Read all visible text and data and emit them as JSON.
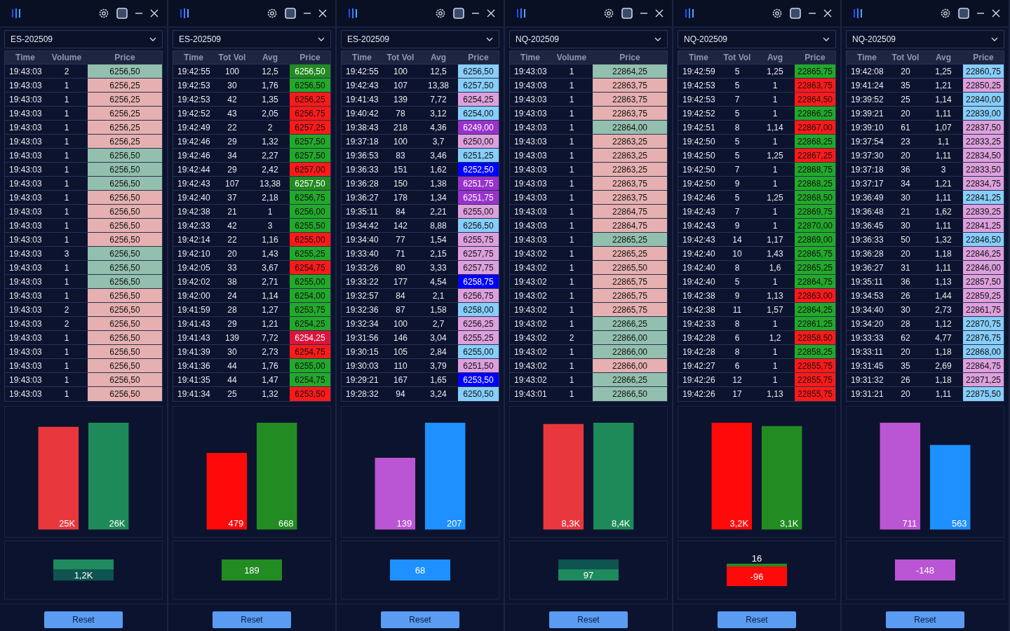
{
  "panels": [
    {
      "symbol": "ES-202509",
      "columns": [
        "Time",
        "Volume",
        "Price"
      ],
      "rows": [
        {
          "cells": [
            "19:43:03",
            "2",
            "6256,50"
          ],
          "color": "#93bfae"
        },
        {
          "cells": [
            "19:43:03",
            "1",
            "6256,25"
          ],
          "color": "#e6b0b0"
        },
        {
          "cells": [
            "19:43:03",
            "1",
            "6256,25"
          ],
          "color": "#e6b0b0"
        },
        {
          "cells": [
            "19:43:03",
            "1",
            "6256,25"
          ],
          "color": "#e6b0b0"
        },
        {
          "cells": [
            "19:43:03",
            "1",
            "6256,25"
          ],
          "color": "#e6b0b0"
        },
        {
          "cells": [
            "19:43:03",
            "1",
            "6256,25"
          ],
          "color": "#e6b0b0"
        },
        {
          "cells": [
            "19:43:03",
            "1",
            "6256,50"
          ],
          "color": "#93bfae"
        },
        {
          "cells": [
            "19:43:03",
            "1",
            "6256,50"
          ],
          "color": "#93bfae"
        },
        {
          "cells": [
            "19:43:03",
            "1",
            "6256,50"
          ],
          "color": "#93bfae"
        },
        {
          "cells": [
            "19:43:03",
            "1",
            "6256,50"
          ],
          "color": "#e6b0b0"
        },
        {
          "cells": [
            "19:43:03",
            "1",
            "6256,50"
          ],
          "color": "#e6b0b0"
        },
        {
          "cells": [
            "19:43:03",
            "1",
            "6256,50"
          ],
          "color": "#e6b0b0"
        },
        {
          "cells": [
            "19:43:03",
            "1",
            "6256,50"
          ],
          "color": "#e6b0b0"
        },
        {
          "cells": [
            "19:43:03",
            "3",
            "6256,50"
          ],
          "color": "#93bfae"
        },
        {
          "cells": [
            "19:43:03",
            "1",
            "6256,50"
          ],
          "color": "#93bfae"
        },
        {
          "cells": [
            "19:43:03",
            "1",
            "6256,50"
          ],
          "color": "#93bfae"
        },
        {
          "cells": [
            "19:43:03",
            "1",
            "6256,50"
          ],
          "color": "#e6b0b0"
        },
        {
          "cells": [
            "19:43:03",
            "2",
            "6256,50"
          ],
          "color": "#e6b0b0"
        },
        {
          "cells": [
            "19:43:03",
            "2",
            "6256,50"
          ],
          "color": "#e6b0b0"
        },
        {
          "cells": [
            "19:43:03",
            "1",
            "6256,50"
          ],
          "color": "#e6b0b0"
        },
        {
          "cells": [
            "19:43:03",
            "1",
            "6256,50"
          ],
          "color": "#e6b0b0"
        },
        {
          "cells": [
            "19:43:03",
            "1",
            "6256,50"
          ],
          "color": "#e6b0b0"
        },
        {
          "cells": [
            "19:43:03",
            "1",
            "6256,50"
          ],
          "color": "#e6b0b0"
        },
        {
          "cells": [
            "19:43:03",
            "1",
            "6256,50"
          ],
          "color": "#e6b0b0"
        }
      ],
      "chart_data": {
        "type": "bar",
        "values": [
          25000,
          26000
        ],
        "value_labels": [
          "25K",
          "26K"
        ],
        "colors": [
          "#e8383d",
          "#1e8a5a"
        ]
      },
      "delta": {
        "label": "1,2K",
        "color": "#0e5450",
        "cap": {
          "color": "#1e8a5e"
        }
      },
      "reset": "Reset"
    },
    {
      "symbol": "ES-202509",
      "columns": [
        "Time",
        "Tot Vol",
        "Avg",
        "Price"
      ],
      "rows": [
        {
          "cells": [
            "19:42:55",
            "100",
            "12,5",
            "6256,50"
          ],
          "color": "#228b22"
        },
        {
          "cells": [
            "19:42:53",
            "30",
            "1,76",
            "6256,50"
          ],
          "color": "#22a82a"
        },
        {
          "cells": [
            "19:42:53",
            "42",
            "1,35",
            "6256,25"
          ],
          "color": "#ff1a1a"
        },
        {
          "cells": [
            "19:42:52",
            "43",
            "2,05",
            "6256,75"
          ],
          "color": "#ff1a1a"
        },
        {
          "cells": [
            "19:42:49",
            "22",
            "2",
            "6257,25"
          ],
          "color": "#ff1a1a"
        },
        {
          "cells": [
            "19:42:46",
            "29",
            "1,32",
            "6257,50"
          ],
          "color": "#22a82a"
        },
        {
          "cells": [
            "19:42:46",
            "34",
            "2,27",
            "6257,50"
          ],
          "color": "#22a82a"
        },
        {
          "cells": [
            "19:42:44",
            "29",
            "2,42",
            "6257,00"
          ],
          "color": "#ff1a1a"
        },
        {
          "cells": [
            "19:42:43",
            "107",
            "13,38",
            "6257,50"
          ],
          "color": "#228b22"
        },
        {
          "cells": [
            "19:42:40",
            "37",
            "2,18",
            "6256,75"
          ],
          "color": "#22a82a"
        },
        {
          "cells": [
            "19:42:38",
            "21",
            "1",
            "6256,00"
          ],
          "color": "#22a82a"
        },
        {
          "cells": [
            "19:42:33",
            "42",
            "3",
            "6255,50"
          ],
          "color": "#22a82a"
        },
        {
          "cells": [
            "19:42:14",
            "22",
            "1,16",
            "6255,00"
          ],
          "color": "#ff1a1a"
        },
        {
          "cells": [
            "19:42:10",
            "20",
            "1,43",
            "6255,25"
          ],
          "color": "#22a82a"
        },
        {
          "cells": [
            "19:42:05",
            "33",
            "3,67",
            "6254,75"
          ],
          "color": "#ff1a1a"
        },
        {
          "cells": [
            "19:42:02",
            "38",
            "2,71",
            "6255,00"
          ],
          "color": "#22a82a"
        },
        {
          "cells": [
            "19:42:00",
            "24",
            "1,14",
            "6254,00"
          ],
          "color": "#22a82a"
        },
        {
          "cells": [
            "19:41:59",
            "28",
            "1,27",
            "6253,75"
          ],
          "color": "#22a82a"
        },
        {
          "cells": [
            "19:41:43",
            "29",
            "1,21",
            "6254,25"
          ],
          "color": "#22a82a"
        },
        {
          "cells": [
            "19:41:43",
            "139",
            "7,72",
            "6254,25"
          ],
          "color": "#dc143c"
        },
        {
          "cells": [
            "19:41:39",
            "30",
            "2,73",
            "6254,75"
          ],
          "color": "#ff1a1a"
        },
        {
          "cells": [
            "19:41:36",
            "44",
            "1,76",
            "6255,00"
          ],
          "color": "#22a82a"
        },
        {
          "cells": [
            "19:41:35",
            "44",
            "1,47",
            "6254,75"
          ],
          "color": "#22a82a"
        },
        {
          "cells": [
            "19:41:34",
            "25",
            "1,32",
            "6253,50"
          ],
          "color": "#ff1a1a"
        }
      ],
      "chart_data": {
        "type": "bar",
        "values": [
          479,
          668
        ],
        "value_labels": [
          "479",
          "668"
        ],
        "colors": [
          "#ff0a0a",
          "#228b22"
        ]
      },
      "delta": {
        "label": "189",
        "color": "#228b22"
      },
      "reset": "Reset"
    },
    {
      "symbol": "ES-202509",
      "columns": [
        "Time",
        "Tot Vol",
        "Avg",
        "Price"
      ],
      "rows": [
        {
          "cells": [
            "19:42:55",
            "100",
            "12,5",
            "6256,50"
          ],
          "color": "#87cefa"
        },
        {
          "cells": [
            "19:42:43",
            "107",
            "13,38",
            "6257,50"
          ],
          "color": "#87cefa"
        },
        {
          "cells": [
            "19:41:43",
            "139",
            "7,72",
            "6254,25"
          ],
          "color": "#dda0dd"
        },
        {
          "cells": [
            "19:40:42",
            "78",
            "3,12",
            "6254,00"
          ],
          "color": "#87cefa"
        },
        {
          "cells": [
            "19:38:43",
            "218",
            "4,36",
            "6249,00"
          ],
          "color": "#9932cc"
        },
        {
          "cells": [
            "19:37:18",
            "100",
            "3,7",
            "6250,00"
          ],
          "color": "#dda0dd"
        },
        {
          "cells": [
            "19:36:53",
            "83",
            "3,46",
            "6251,25"
          ],
          "color": "#87cefa"
        },
        {
          "cells": [
            "19:36:33",
            "151",
            "1,62",
            "6252,50"
          ],
          "color": "#0000ff"
        },
        {
          "cells": [
            "19:36:28",
            "150",
            "1,38",
            "6251,75"
          ],
          "color": "#9932cc"
        },
        {
          "cells": [
            "19:36:27",
            "178",
            "1,34",
            "6251,75"
          ],
          "color": "#9932cc"
        },
        {
          "cells": [
            "19:35:11",
            "84",
            "2,21",
            "6255,00"
          ],
          "color": "#dda0dd"
        },
        {
          "cells": [
            "19:34:42",
            "142",
            "8,88",
            "6256,50"
          ],
          "color": "#87cefa"
        },
        {
          "cells": [
            "19:34:40",
            "77",
            "1,54",
            "6255,75"
          ],
          "color": "#dda0dd"
        },
        {
          "cells": [
            "19:33:40",
            "71",
            "2,15",
            "6257,75"
          ],
          "color": "#dda0dd"
        },
        {
          "cells": [
            "19:33:26",
            "80",
            "3,33",
            "6257,75"
          ],
          "color": "#dda0dd"
        },
        {
          "cells": [
            "19:33:22",
            "177",
            "4,54",
            "6258,75"
          ],
          "color": "#0000ff"
        },
        {
          "cells": [
            "19:32:57",
            "84",
            "2,1",
            "6256,75"
          ],
          "color": "#dda0dd"
        },
        {
          "cells": [
            "19:32:36",
            "87",
            "1,58",
            "6258,00"
          ],
          "color": "#87cefa"
        },
        {
          "cells": [
            "19:32:34",
            "100",
            "2,7",
            "6256,25"
          ],
          "color": "#dda0dd"
        },
        {
          "cells": [
            "19:31:56",
            "146",
            "3,04",
            "6255,25"
          ],
          "color": "#dda0dd"
        },
        {
          "cells": [
            "19:30:15",
            "105",
            "2,84",
            "6255,00"
          ],
          "color": "#87cefa"
        },
        {
          "cells": [
            "19:30:03",
            "110",
            "3,79",
            "6251,50"
          ],
          "color": "#dda0dd"
        },
        {
          "cells": [
            "19:29:21",
            "167",
            "1,65",
            "6253,50"
          ],
          "color": "#0000ff"
        },
        {
          "cells": [
            "19:28:32",
            "94",
            "3,24",
            "6250,50"
          ],
          "color": "#87cefa"
        }
      ],
      "chart_data": {
        "type": "bar",
        "values": [
          139,
          207
        ],
        "value_labels": [
          "139",
          "207"
        ],
        "colors": [
          "#ba55d3",
          "#1e90ff"
        ]
      },
      "delta": {
        "label": "68",
        "color": "#1e90ff"
      },
      "reset": "Reset"
    },
    {
      "symbol": "NQ-202509",
      "columns": [
        "Time",
        "Volume",
        "Price"
      ],
      "rows": [
        {
          "cells": [
            "19:43:03",
            "1",
            "22864,25"
          ],
          "color": "#93bfae"
        },
        {
          "cells": [
            "19:43:03",
            "1",
            "22863,75"
          ],
          "color": "#e6b0b0"
        },
        {
          "cells": [
            "19:43:03",
            "1",
            "22863,75"
          ],
          "color": "#e6b0b0"
        },
        {
          "cells": [
            "19:43:03",
            "1",
            "22863,75"
          ],
          "color": "#e6b0b0"
        },
        {
          "cells": [
            "19:43:03",
            "1",
            "22864,00"
          ],
          "color": "#93bfae"
        },
        {
          "cells": [
            "19:43:03",
            "1",
            "22863,25"
          ],
          "color": "#e6b0b0"
        },
        {
          "cells": [
            "19:43:03",
            "1",
            "22863,25"
          ],
          "color": "#e6b0b0"
        },
        {
          "cells": [
            "19:43:03",
            "1",
            "22863,25"
          ],
          "color": "#e6b0b0"
        },
        {
          "cells": [
            "19:43:03",
            "1",
            "22863,75"
          ],
          "color": "#e6b0b0"
        },
        {
          "cells": [
            "19:43:03",
            "1",
            "22863,75"
          ],
          "color": "#e6b0b0"
        },
        {
          "cells": [
            "19:43:03",
            "1",
            "22864,75"
          ],
          "color": "#e6b0b0"
        },
        {
          "cells": [
            "19:43:03",
            "1",
            "22864,75"
          ],
          "color": "#e6b0b0"
        },
        {
          "cells": [
            "19:43:03",
            "1",
            "22865,25"
          ],
          "color": "#93bfae"
        },
        {
          "cells": [
            "19:43:02",
            "1",
            "22865,25"
          ],
          "color": "#e6b0b0"
        },
        {
          "cells": [
            "19:43:02",
            "1",
            "22865,50"
          ],
          "color": "#e6b0b0"
        },
        {
          "cells": [
            "19:43:02",
            "1",
            "22865,75"
          ],
          "color": "#e6b0b0"
        },
        {
          "cells": [
            "19:43:02",
            "1",
            "22865,75"
          ],
          "color": "#e6b0b0"
        },
        {
          "cells": [
            "19:43:02",
            "1",
            "22865,75"
          ],
          "color": "#e6b0b0"
        },
        {
          "cells": [
            "19:43:02",
            "1",
            "22866,25"
          ],
          "color": "#93bfae"
        },
        {
          "cells": [
            "19:43:02",
            "2",
            "22866,00"
          ],
          "color": "#93bfae"
        },
        {
          "cells": [
            "19:43:02",
            "1",
            "22866,00"
          ],
          "color": "#93bfae"
        },
        {
          "cells": [
            "19:43:02",
            "1",
            "22866,00"
          ],
          "color": "#e6b0b0"
        },
        {
          "cells": [
            "19:43:02",
            "1",
            "22866,25"
          ],
          "color": "#93bfae"
        },
        {
          "cells": [
            "19:43:01",
            "1",
            "22866,50"
          ],
          "color": "#93bfae"
        }
      ],
      "chart_data": {
        "type": "bar",
        "values": [
          8300,
          8400
        ],
        "value_labels": [
          "8,3K",
          "8,4K"
        ],
        "colors": [
          "#e8383d",
          "#1e8a5a"
        ]
      },
      "delta": {
        "label": "97",
        "color": "#1e8a5e",
        "cap": {
          "color": "#0e5450"
        }
      },
      "reset": "Reset"
    },
    {
      "symbol": "NQ-202509",
      "columns": [
        "Time",
        "Tot Vol",
        "Avg",
        "Price"
      ],
      "rows": [
        {
          "cells": [
            "19:42:59",
            "5",
            "1,25",
            "22865,75"
          ],
          "color": "#22a82a"
        },
        {
          "cells": [
            "19:42:53",
            "5",
            "1",
            "22863,75"
          ],
          "color": "#ff1a1a"
        },
        {
          "cells": [
            "19:42:53",
            "7",
            "1",
            "22864,50"
          ],
          "color": "#ff1a1a"
        },
        {
          "cells": [
            "19:42:52",
            "5",
            "1",
            "22866,25"
          ],
          "color": "#22a82a"
        },
        {
          "cells": [
            "19:42:51",
            "8",
            "1,14",
            "22867,00"
          ],
          "color": "#ff1a1a"
        },
        {
          "cells": [
            "19:42:50",
            "5",
            "1",
            "22868,25"
          ],
          "color": "#22a82a"
        },
        {
          "cells": [
            "19:42:50",
            "5",
            "1,25",
            "22867,25"
          ],
          "color": "#ff1a1a"
        },
        {
          "cells": [
            "19:42:50",
            "7",
            "1",
            "22868,75"
          ],
          "color": "#22a82a"
        },
        {
          "cells": [
            "19:42:50",
            "9",
            "1",
            "22868,25"
          ],
          "color": "#22a82a"
        },
        {
          "cells": [
            "19:42:46",
            "5",
            "1,25",
            "22868,50"
          ],
          "color": "#22a82a"
        },
        {
          "cells": [
            "19:42:43",
            "7",
            "1",
            "22869,75"
          ],
          "color": "#22a82a"
        },
        {
          "cells": [
            "19:42:43",
            "9",
            "1",
            "22870,00"
          ],
          "color": "#22a82a"
        },
        {
          "cells": [
            "19:42:43",
            "14",
            "1,17",
            "22869,00"
          ],
          "color": "#22a82a"
        },
        {
          "cells": [
            "19:42:40",
            "10",
            "1,43",
            "22865,75"
          ],
          "color": "#22a82a"
        },
        {
          "cells": [
            "19:42:40",
            "8",
            "1,6",
            "22865,25"
          ],
          "color": "#22a82a"
        },
        {
          "cells": [
            "19:42:40",
            "5",
            "1",
            "22864,75"
          ],
          "color": "#22a82a"
        },
        {
          "cells": [
            "19:42:38",
            "9",
            "1,13",
            "22863,00"
          ],
          "color": "#ff1a1a"
        },
        {
          "cells": [
            "19:42:38",
            "11",
            "1,57",
            "22864,25"
          ],
          "color": "#22a82a"
        },
        {
          "cells": [
            "19:42:33",
            "8",
            "1",
            "22861,25"
          ],
          "color": "#22a82a"
        },
        {
          "cells": [
            "19:42:28",
            "6",
            "1,2",
            "22858,50"
          ],
          "color": "#ff1a1a"
        },
        {
          "cells": [
            "19:42:28",
            "8",
            "1",
            "22858,25"
          ],
          "color": "#22a82a"
        },
        {
          "cells": [
            "19:42:27",
            "6",
            "1",
            "22855,75"
          ],
          "color": "#ff1a1a"
        },
        {
          "cells": [
            "19:42:26",
            "12",
            "1",
            "22855,75"
          ],
          "color": "#ff1a1a"
        },
        {
          "cells": [
            "19:42:26",
            "17",
            "1,13",
            "22855,75"
          ],
          "color": "#ff1a1a"
        }
      ],
      "chart_data": {
        "type": "bar",
        "values": [
          3200,
          3100
        ],
        "value_labels": [
          "3,2K",
          "3,1K"
        ],
        "colors": [
          "#ff0a0a",
          "#228b22"
        ]
      },
      "delta": {
        "label": "-96",
        "color": "#ff0a0a",
        "cap": {
          "color": "#228b22",
          "label": "16"
        }
      },
      "reset": "Reset"
    },
    {
      "symbol": "NQ-202509",
      "columns": [
        "Time",
        "Tot Vol",
        "Avg",
        "Price"
      ],
      "rows": [
        {
          "cells": [
            "19:42:08",
            "20",
            "1,25",
            "22860,75"
          ],
          "color": "#87cefa"
        },
        {
          "cells": [
            "19:41:24",
            "35",
            "1,21",
            "22850,25"
          ],
          "color": "#dda0dd"
        },
        {
          "cells": [
            "19:39:52",
            "25",
            "1,14",
            "22840,00"
          ],
          "color": "#87cefa"
        },
        {
          "cells": [
            "19:39:21",
            "20",
            "1,11",
            "22839,00"
          ],
          "color": "#87cefa"
        },
        {
          "cells": [
            "19:39:10",
            "61",
            "1,07",
            "22837,50"
          ],
          "color": "#dda0dd"
        },
        {
          "cells": [
            "19:37:54",
            "23",
            "1,1",
            "22833,25"
          ],
          "color": "#dda0dd"
        },
        {
          "cells": [
            "19:37:30",
            "20",
            "1,11",
            "22834,50"
          ],
          "color": "#dda0dd"
        },
        {
          "cells": [
            "19:37:18",
            "36",
            "3",
            "22833,50"
          ],
          "color": "#dda0dd"
        },
        {
          "cells": [
            "19:37:17",
            "34",
            "1,21",
            "22834,75"
          ],
          "color": "#dda0dd"
        },
        {
          "cells": [
            "19:36:49",
            "30",
            "1,11",
            "22841,25"
          ],
          "color": "#87cefa"
        },
        {
          "cells": [
            "19:36:48",
            "21",
            "1,62",
            "22839,25"
          ],
          "color": "#dda0dd"
        },
        {
          "cells": [
            "19:36:45",
            "30",
            "1,11",
            "22841,25"
          ],
          "color": "#dda0dd"
        },
        {
          "cells": [
            "19:36:33",
            "50",
            "1,32",
            "22846,50"
          ],
          "color": "#87cefa"
        },
        {
          "cells": [
            "19:36:28",
            "20",
            "1,18",
            "22846,25"
          ],
          "color": "#dda0dd"
        },
        {
          "cells": [
            "19:36:27",
            "31",
            "1,11",
            "22846,00"
          ],
          "color": "#dda0dd"
        },
        {
          "cells": [
            "19:35:11",
            "36",
            "1,13",
            "22857,50"
          ],
          "color": "#dda0dd"
        },
        {
          "cells": [
            "19:34:53",
            "26",
            "1,44",
            "22859,25"
          ],
          "color": "#dda0dd"
        },
        {
          "cells": [
            "19:34:40",
            "30",
            "2,73",
            "22861,75"
          ],
          "color": "#dda0dd"
        },
        {
          "cells": [
            "19:34:20",
            "28",
            "1,12",
            "22870,75"
          ],
          "color": "#87cefa"
        },
        {
          "cells": [
            "19:33:33",
            "62",
            "4,77",
            "22876,75"
          ],
          "color": "#87cefa"
        },
        {
          "cells": [
            "19:33:11",
            "20",
            "1,18",
            "22868,00"
          ],
          "color": "#87cefa"
        },
        {
          "cells": [
            "19:31:45",
            "35",
            "2,69",
            "22864,75"
          ],
          "color": "#dda0dd"
        },
        {
          "cells": [
            "19:31:32",
            "26",
            "1,18",
            "22871,25"
          ],
          "color": "#dda0dd"
        },
        {
          "cells": [
            "19:31:21",
            "20",
            "1,11",
            "22875,50"
          ],
          "color": "#87cefa"
        }
      ],
      "chart_data": {
        "type": "bar",
        "values": [
          711,
          563
        ],
        "value_labels": [
          "711",
          "563"
        ],
        "colors": [
          "#ba55d3",
          "#1e90ff"
        ]
      },
      "delta": {
        "label": "-148",
        "color": "#ba55d3"
      },
      "reset": "Reset"
    }
  ]
}
